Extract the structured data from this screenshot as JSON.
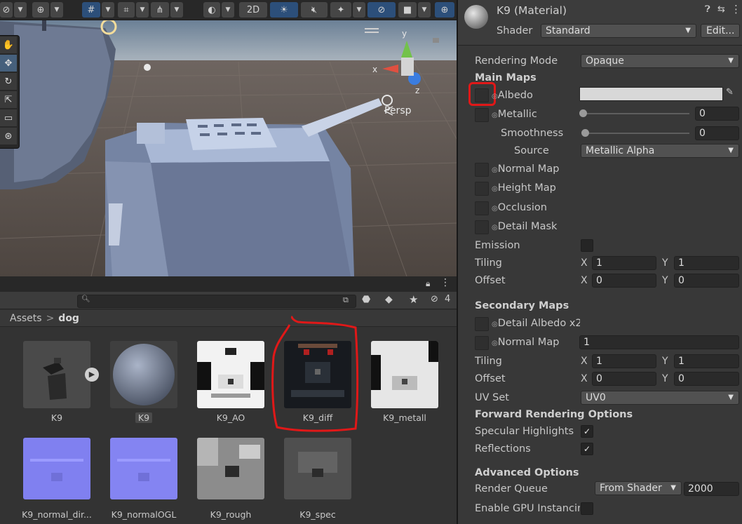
{
  "scene": {
    "toolbar": {
      "mode_2d": "2D"
    },
    "persp_label": "Persp",
    "gizmo": {
      "x": "x",
      "y": "y",
      "z": "z"
    }
  },
  "project": {
    "hidden_count": "4",
    "breadcrumb": {
      "root": "Assets",
      "separator": ">",
      "current": "dog"
    },
    "assets": [
      {
        "name": "K9",
        "type": "model"
      },
      {
        "name": "K9",
        "type": "material",
        "selected": true
      },
      {
        "name": "K9_AO",
        "type": "texture"
      },
      {
        "name": "K9_diff",
        "type": "texture"
      },
      {
        "name": "K9_metall",
        "type": "texture"
      },
      {
        "name": "K9_normal_dir...",
        "type": "normalmap"
      },
      {
        "name": "K9_normalOGL",
        "type": "normalmap"
      },
      {
        "name": "K9_rough",
        "type": "texture"
      },
      {
        "name": "K9_spec",
        "type": "texture"
      }
    ]
  },
  "inspector": {
    "title": "K9 (Material)",
    "shader_label": "Shader",
    "shader_value": "Standard",
    "edit_button": "Edit...",
    "rendering_mode_label": "Rendering Mode",
    "rendering_mode_value": "Opaque",
    "main_maps": "Main Maps",
    "albedo": "Albedo",
    "albedo_color": "#d8d8d8",
    "metallic": "Metallic",
    "metallic_value": "0",
    "smoothness": "Smoothness",
    "smoothness_value": "0",
    "source": "Source",
    "source_value": "Metallic Alpha",
    "normal_map": "Normal Map",
    "height_map": "Height Map",
    "occlusion": "Occlusion",
    "detail_mask": "Detail Mask",
    "emission": "Emission",
    "tiling": "Tiling",
    "offset": "Offset",
    "x": "X",
    "y": "Y",
    "main_tiling_x": "1",
    "main_tiling_y": "1",
    "main_offset_x": "0",
    "main_offset_y": "0",
    "secondary_maps": "Secondary Maps",
    "detail_albedo": "Detail Albedo x2",
    "sec_normal_map": "Normal Map",
    "sec_normal_value": "1",
    "sec_tiling_x": "1",
    "sec_tiling_y": "1",
    "sec_offset_x": "0",
    "sec_offset_y": "0",
    "uv_set": "UV Set",
    "uv_set_value": "UV0",
    "forward_options": "Forward Rendering Options",
    "specular_highlights": "Specular Highlights",
    "specular_checked": true,
    "reflections": "Reflections",
    "reflections_checked": true,
    "advanced_options": "Advanced Options",
    "render_queue": "Render Queue",
    "render_queue_mode": "From Shader",
    "render_queue_value": "2000",
    "gpu_instancing": "Enable GPU Instancing"
  },
  "annotation_color": "#e01818"
}
